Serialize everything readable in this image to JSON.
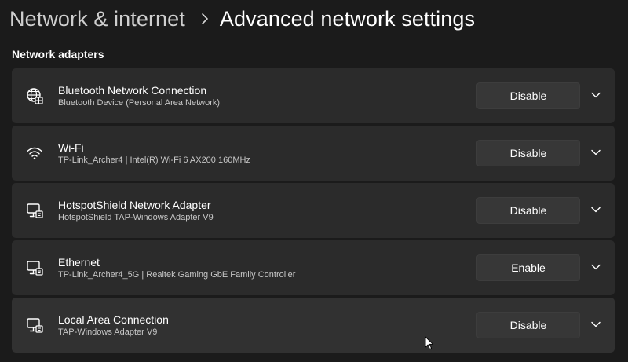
{
  "breadcrumb": {
    "parent": "Network & internet",
    "current": "Advanced network settings"
  },
  "section": {
    "title": "Network adapters"
  },
  "adapters": [
    {
      "name": "Bluetooth Network Connection",
      "description": "Bluetooth Device (Personal Area Network)",
      "action_label": "Disable",
      "icon": "globe-network-icon"
    },
    {
      "name": "Wi-Fi",
      "description": "TP-Link_Archer4 | Intel(R) Wi-Fi 6 AX200 160MHz",
      "action_label": "Disable",
      "icon": "wifi-icon"
    },
    {
      "name": "HotspotShield Network Adapter",
      "description": "HotspotShield TAP-Windows Adapter V9",
      "action_label": "Disable",
      "icon": "ethernet-monitor-icon"
    },
    {
      "name": "Ethernet",
      "description": "TP-Link_Archer4_5G | Realtek Gaming GbE Family Controller",
      "action_label": "Enable",
      "icon": "ethernet-monitor-icon"
    },
    {
      "name": "Local Area Connection",
      "description": "TAP-Windows Adapter V9",
      "action_label": "Disable",
      "icon": "ethernet-monitor-icon"
    }
  ],
  "colors": {
    "background": "#1b1b1b",
    "card": "#2b2b2b",
    "button": "#373737",
    "text": "#ffffff",
    "secondary_text": "#c8c8c8"
  }
}
